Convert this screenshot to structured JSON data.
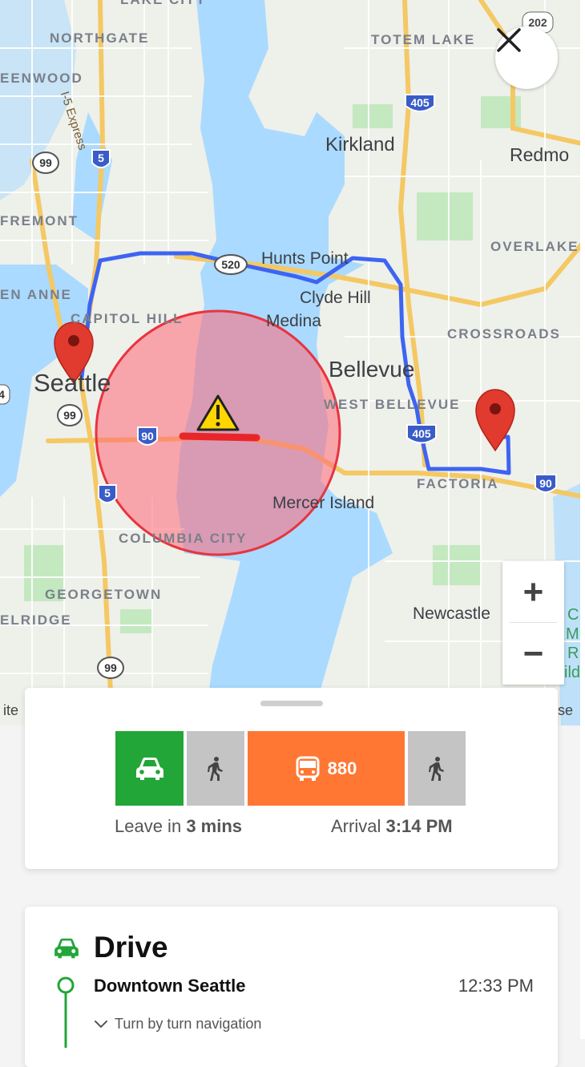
{
  "map": {
    "neighborhoods": [
      "LAKE CITY",
      "NORTHGATE",
      "TOTEM LAKE",
      "EENWOOD",
      "FREMONT",
      "EN ANNE",
      "CAPITOL HILL",
      "OVERLAKE",
      "CROSSROADS",
      "WEST BELLEVUE",
      "FACTORIA",
      "COLUMBIA CITY",
      "GEORGETOWN",
      "ELRIDGE"
    ],
    "cities": [
      "Kirkland",
      "Redmo",
      "Hunts Point",
      "Clyde Hill",
      "Medina",
      "Bellevue",
      "Seattle",
      "Mercer Island",
      "Newcastle"
    ],
    "route_labels": [
      "I-5 Express"
    ],
    "shields": [
      "202",
      "405",
      "99",
      "5",
      "520",
      "99",
      "90",
      "405",
      "5",
      "90",
      "99",
      "4"
    ],
    "corner_labels": [
      "ite",
      "se"
    ],
    "edge_text": [
      "C",
      "M",
      "R",
      "ild"
    ],
    "icons": {
      "incident": "warning-icon",
      "start": "map-pin-icon",
      "end": "map-pin-icon"
    },
    "colors": {
      "route": "#3d64f2",
      "incident_zone": "#ff5566",
      "traffic": "#e8262a",
      "pin": "#e13a2e"
    }
  },
  "controls": {
    "close_icon": "close-icon",
    "zoom_in": "+",
    "zoom_out": "−"
  },
  "trip": {
    "modes": [
      {
        "icon": "car-icon",
        "color": "#22a638"
      },
      {
        "icon": "walk-icon",
        "color": "#c4c4c4"
      },
      {
        "icon": "bus-icon",
        "label": "880",
        "color": "#ff7733"
      },
      {
        "icon": "walk-icon",
        "color": "#c4c4c4"
      }
    ],
    "leave_prefix": "Leave in",
    "leave_value": "3 mins",
    "arrival_prefix": "Arrival",
    "arrival_value": "3:14 PM"
  },
  "steps": {
    "mode_title": "Drive",
    "origin": "Downtown Seattle",
    "time": "12:33 PM",
    "nav_label": "Turn by turn navigation"
  }
}
